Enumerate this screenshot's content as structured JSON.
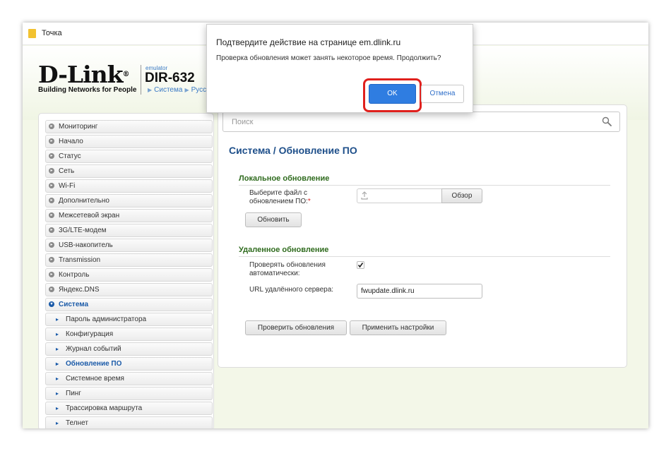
{
  "tab": {
    "title": "Точка"
  },
  "header": {
    "logo": "D-Link",
    "logo_reg": "®",
    "logo_subtitle": "Building Networks for People",
    "emulator_label": "emulator",
    "model": "DIR-632",
    "breadcrumb": [
      "Система",
      "Русс"
    ]
  },
  "sidebar": {
    "items": [
      "Мониторинг",
      "Начало",
      "Статус",
      "Сеть",
      "Wi-Fi",
      "Дополнительно",
      "Межсетевой экран",
      "3G/LTE-модем",
      "USB-накопитель",
      "Transmission",
      "Контроль",
      "Яндекс.DNS"
    ],
    "open_item": "Система",
    "sub_items": [
      "Пароль администратора",
      "Конфигурация",
      "Журнал событий",
      "Обновление ПО",
      "Системное время",
      "Пинг",
      "Трассировка маршрута",
      "Телнет"
    ],
    "active_sub_item": "Обновление ПО"
  },
  "search": {
    "placeholder": "Поиск"
  },
  "page": {
    "title_parent": "Система /",
    "title_current": "Обновление ПО"
  },
  "local_update": {
    "title": "Локальное обновление",
    "file_label": "Выберите файл с обновлением ПО:",
    "required_mark": "*",
    "browse_label": "Обзор",
    "update_button": "Обновить"
  },
  "remote_update": {
    "title": "Удаленное обновление",
    "auto_check_label": "Проверять обновления автоматически:",
    "auto_check_checked": true,
    "server_url_label": "URL удалённого сервера:",
    "server_url_value": "fwupdate.dlink.ru",
    "check_button": "Проверить обновления",
    "apply_button": "Применить настройки"
  },
  "dialog": {
    "title": "Подтвердите действие на странице em.dlink.ru",
    "message": "Проверка обновления может занять некоторое время. Продолжить?",
    "ok_label": "OK",
    "cancel_label": "Отмена"
  },
  "colors": {
    "accent_blue": "#1e4f8a",
    "section_green": "#2f6b1e",
    "ok_button": "#2f7de1",
    "highlight_ring": "#e0201d",
    "page_background": "#f3f7e8"
  }
}
